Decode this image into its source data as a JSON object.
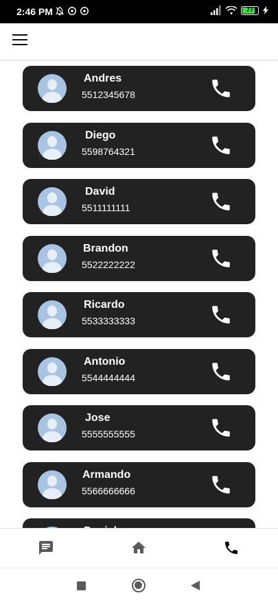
{
  "status_bar": {
    "time": "2:46 PM",
    "battery_level": "77",
    "battery_fraction": 0.77,
    "left_icons": [
      "muted-bell-icon",
      "sync-icon",
      "sync-icon"
    ],
    "right_icons": [
      "signal-icon",
      "wifi-icon",
      "battery-icon",
      "charging-icon"
    ]
  },
  "app_bar": {
    "menu_icon": "hamburger-menu-icon"
  },
  "contacts": [
    {
      "name": "Andres",
      "phone": "5512345678"
    },
    {
      "name": "Diego",
      "phone": "5598764321"
    },
    {
      "name": "David",
      "phone": "5511111111"
    },
    {
      "name": "Brandon",
      "phone": "5522222222"
    },
    {
      "name": "Ricardo",
      "phone": "5533333333"
    },
    {
      "name": "Antonio",
      "phone": "5544444444"
    },
    {
      "name": "Jose",
      "phone": "5555555555"
    },
    {
      "name": "Armando",
      "phone": "5566666666"
    },
    {
      "name": "Daniel",
      "phone": ""
    }
  ],
  "bottom_nav": {
    "items": [
      "message-icon",
      "home-icon",
      "phone-icon"
    ]
  },
  "system_nav": {
    "items": [
      "recents-square-icon",
      "home-circle-icon",
      "back-triangle-icon"
    ]
  },
  "colors": {
    "card_background": "#222222",
    "card_text": "#ffffff",
    "avatar_background": "#a9c4e2",
    "avatar_figure": "#e6eef8",
    "nav_icon": "#5a5a5a",
    "active_nav_icon": "#000000",
    "battery_fill": "#3ddc3d"
  }
}
